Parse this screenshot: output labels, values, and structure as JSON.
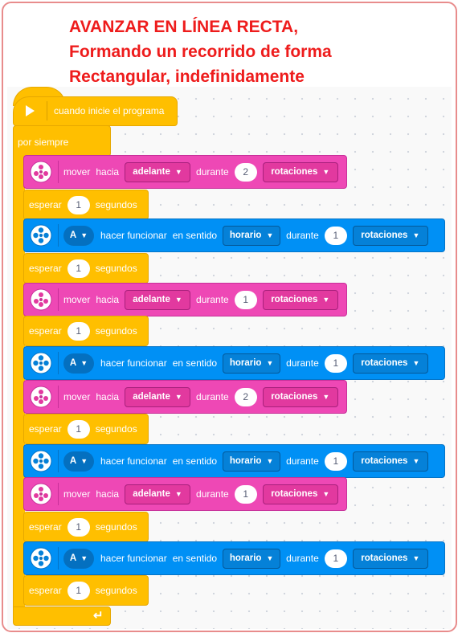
{
  "title": {
    "line1": "AVANZAR EN LÍNEA RECTA,",
    "line2": "Formando un recorrido de forma",
    "line3": "Rectangular, indefinidamente"
  },
  "hat": {
    "label": "cuando inicie el programa",
    "icon": "play-icon"
  },
  "forever": {
    "label": "por siempre",
    "icon": "loop-arrow-icon"
  },
  "colors": {
    "motor": "#ee48b5",
    "drive": "#0090f5",
    "control": "#ffbf00",
    "title": "#ee1c1c"
  },
  "blocks": [
    {
      "type": "motor",
      "move_label": "mover",
      "toward_label": "hacia",
      "direction": "adelante",
      "during_label": "durante",
      "value": "2",
      "unit": "rotaciones"
    },
    {
      "type": "wait",
      "label": "esperar",
      "value": "1",
      "unit": "segundos"
    },
    {
      "type": "drive",
      "port": "A",
      "run_label": "hacer funcionar",
      "sense_label": "en sentido",
      "direction": "horario",
      "during_label": "durante",
      "value": "1",
      "unit": "rotaciones"
    },
    {
      "type": "wait",
      "label": "esperar",
      "value": "1",
      "unit": "segundos"
    },
    {
      "type": "motor",
      "move_label": "mover",
      "toward_label": "hacia",
      "direction": "adelante",
      "during_label": "durante",
      "value": "1",
      "unit": "rotaciones"
    },
    {
      "type": "wait",
      "label": "esperar",
      "value": "1",
      "unit": "segundos"
    },
    {
      "type": "drive",
      "port": "A",
      "run_label": "hacer funcionar",
      "sense_label": "en sentido",
      "direction": "horario",
      "during_label": "durante",
      "value": "1",
      "unit": "rotaciones"
    },
    {
      "type": "motor",
      "move_label": "mover",
      "toward_label": "hacia",
      "direction": "adelante",
      "during_label": "durante",
      "value": "2",
      "unit": "rotaciones"
    },
    {
      "type": "wait",
      "label": "esperar",
      "value": "1",
      "unit": "segundos"
    },
    {
      "type": "drive",
      "port": "A",
      "run_label": "hacer funcionar",
      "sense_label": "en sentido",
      "direction": "horario",
      "during_label": "durante",
      "value": "1",
      "unit": "rotaciones"
    },
    {
      "type": "motor",
      "move_label": "mover",
      "toward_label": "hacia",
      "direction": "adelante",
      "during_label": "durante",
      "value": "1",
      "unit": "rotaciones"
    },
    {
      "type": "wait",
      "label": "esperar",
      "value": "1",
      "unit": "segundos"
    },
    {
      "type": "drive",
      "port": "A",
      "run_label": "hacer funcionar",
      "sense_label": "en sentido",
      "direction": "horario",
      "during_label": "durante",
      "value": "1",
      "unit": "rotaciones"
    },
    {
      "type": "wait",
      "label": "esperar",
      "value": "1",
      "unit": "segundos"
    }
  ]
}
